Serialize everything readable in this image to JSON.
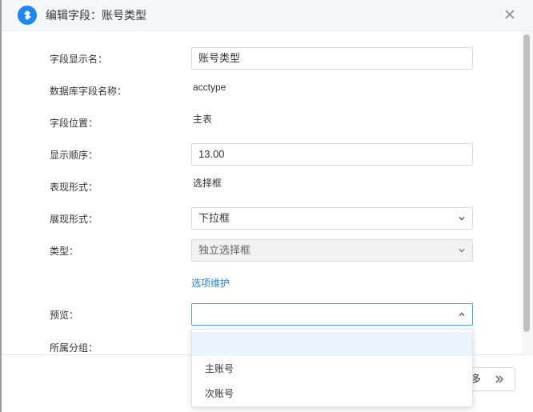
{
  "dialog": {
    "title": "编辑字段：账号类型",
    "accent_color": "#1e87f0"
  },
  "form": {
    "field_display_name": {
      "label": "字段显示名：",
      "value": "账号类型"
    },
    "db_field_name": {
      "label": "数据库字段名称：",
      "value": "acctype"
    },
    "field_position": {
      "label": "字段位置：",
      "value": "主表"
    },
    "display_order": {
      "label": "显示顺序：",
      "value": "13.00"
    },
    "presentation": {
      "label": "表现形式：",
      "value": "选择框"
    },
    "display_form": {
      "label": "展现形式：",
      "value": "下拉框"
    },
    "type": {
      "label": "类型：",
      "value": "独立选择框"
    },
    "options_link": "选项维护",
    "preview": {
      "label": "预览：",
      "value": "",
      "options": [
        "",
        "主账号",
        "次账号"
      ]
    },
    "group": {
      "label": "所属分组："
    }
  },
  "footer": {
    "more_label": "多"
  }
}
